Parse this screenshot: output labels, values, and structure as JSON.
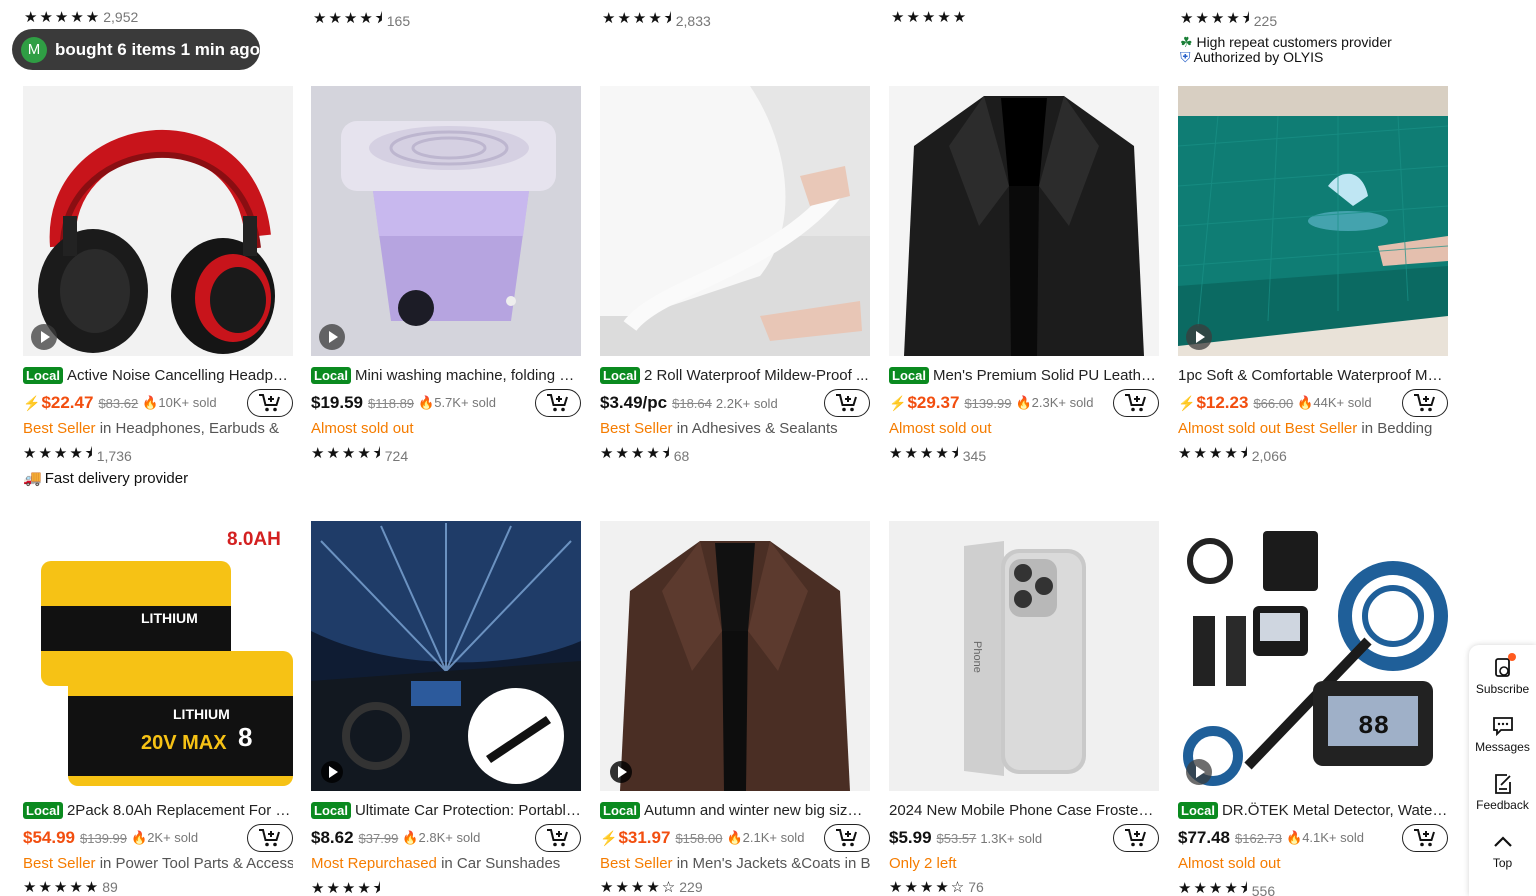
{
  "top_row": [
    {
      "stars": "★★★★★",
      "count": "2,952"
    },
    {
      "stars": "★★★★⯨",
      "count": "165"
    },
    {
      "stars": "★★★★⯨",
      "count": "2,833"
    },
    {
      "stars": "★★★★★",
      "count": ""
    },
    {
      "stars": "★★★★⯨",
      "count": "225",
      "line1": "High repeat customers provider",
      "line2": "Authorized by OLYIS"
    }
  ],
  "toast": {
    "avatar": "M",
    "text": "bought 6 items 1 min ago"
  },
  "products": [
    {
      "local": "Local",
      "title": "Active Noise Cancelling Headpho...",
      "bolt": "⚡",
      "price": "$22.47",
      "orig": "$83.62",
      "sold": "10K+ sold",
      "sub_orange": "Best Seller",
      "sub_rest": " in Headphones, Earbuds &",
      "stars": "★★★★⯨",
      "count": "1,736",
      "extra": "Fast delivery provider"
    },
    {
      "local": "Local",
      "title": "Mini washing machine, folding w...",
      "bolt": "",
      "price": "$19.59",
      "orig": "$118.89",
      "sold": "5.7K+ sold",
      "sub_orange": "Almost sold out",
      "sub_rest": "",
      "stars": "★★★★⯨",
      "count": "724"
    },
    {
      "local": "Local",
      "title": "2 Roll Waterproof Mildew-Proof ...",
      "bolt": "",
      "price": "$3.49/pc",
      "orig": "$18.64",
      "sold": "2.2K+ sold",
      "sub_orange": "Best Seller",
      "sub_rest": " in Adhesives & Sealants",
      "stars": "★★★★⯨",
      "count": "68"
    },
    {
      "local": "Local",
      "title": "Men's Premium Solid PU Leather ...",
      "bolt": "⚡",
      "price": "$29.37",
      "orig": "$139.99",
      "sold": "2.3K+ sold",
      "sub_orange": "Almost sold out",
      "sub_rest": "",
      "stars": "★★★★⯨",
      "count": "345"
    },
    {
      "local": "",
      "title": "1pc Soft & Comfortable Waterproof Ma...",
      "bolt": "⚡",
      "price": "$12.23",
      "orig": "$66.00",
      "sold": "44K+ sold",
      "sub_orange": "Almost sold out  Best Seller",
      "sub_rest": " in Bedding",
      "stars": "★★★★⯨",
      "count": "2,066"
    },
    {
      "local": "Local",
      "title": "2Pack 8.0Ah Replacement For De...",
      "bolt": "",
      "price": "$54.99",
      "orig": "$139.99",
      "sold": "2K+ sold",
      "sub_orange": "Best Seller",
      "sub_rest": " in Power Tool Parts & Access",
      "stars": "★★★★★",
      "count": "89",
      "badge": "8.0AH",
      "label1": "LITHIUM",
      "label2": "20V MAX"
    },
    {
      "local": "Local",
      "title": "Ultimate Car Protection: Portable...",
      "bolt": "",
      "price": "$8.62",
      "orig": "$37.99",
      "sold": "2.8K+ sold",
      "sub_orange": "Most Repurchased",
      "sub_rest": " in Car Sunshades",
      "stars": "★★★★⯨",
      "count": ""
    },
    {
      "local": "Local",
      "title": "Autumn and winter new big size ...",
      "bolt": "⚡",
      "price": "$31.97",
      "orig": "$158.00",
      "sold": "2.1K+ sold",
      "sub_orange": "Best Seller",
      "sub_rest": " in Men's Jackets &Coats in B",
      "stars": "★★★★☆",
      "count": "229"
    },
    {
      "local": "",
      "title": "2024 New Mobile Phone Case Frosted ...",
      "bolt": "",
      "price": "$5.99",
      "orig": "$53.57",
      "sold": "1.3K+ sold",
      "sub_orange": "Only 2 left",
      "sub_rest": "",
      "stars": "★★★★☆",
      "count": "76",
      "box_label": "Phone"
    },
    {
      "local": "Local",
      "title": "DR.ÖTEK Metal Detector, Waterp...",
      "bolt": "",
      "price": "$77.48",
      "orig": "$162.73",
      "sold": "4.1K+ sold",
      "sub_orange": "Almost sold out",
      "sub_rest": "",
      "stars": "★★★★⯨",
      "count": "556",
      "screen": "88"
    }
  ],
  "sidebar": {
    "subscribe": "Subscribe",
    "messages": "Messages",
    "feedback": "Feedback",
    "top": "Top"
  },
  "colors": {
    "accent": "#f24e0f",
    "local_badge": "#0a8a1f",
    "orange_text": "#f57c00"
  }
}
